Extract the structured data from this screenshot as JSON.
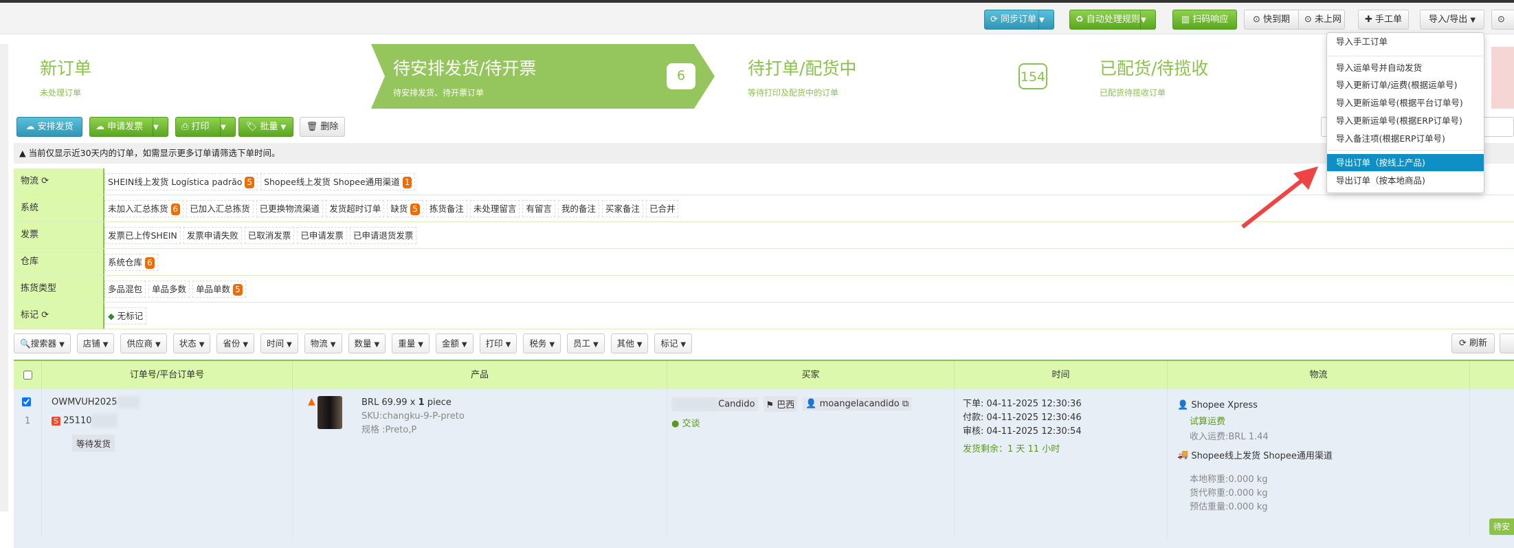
{
  "toolbar": {
    "sync": "同步订单",
    "auto_rules": "自动处理规则",
    "scan": "扫码响应",
    "expiring": "快到期",
    "not_online": "未上网",
    "manual_order": "手工单",
    "import_export": "导入/导出"
  },
  "import_export_menu": [
    "导入手工订单",
    "导入运单号并自动发货",
    "导入更新订单/运费(根据运单号)",
    "导入更新运单号(根据平台订单号)",
    "导入更新运单号(根据ERP订单号)",
    "导入备注项(根据ERP订单号)",
    "导出订单（按线上产品)",
    "导出订单（按本地商品)"
  ],
  "stages": [
    {
      "title": "新订单",
      "sub": "未处理订单",
      "count": null
    },
    {
      "title": "待安排发货/待开票",
      "sub": "待安排发货、待开票订单",
      "count": "6"
    },
    {
      "title": "待打单/配货中",
      "sub": "等待打印及配货中的订单",
      "count": "154"
    },
    {
      "title": "已配货/待揽收",
      "sub": "已配货待揽收订单",
      "count": null
    }
  ],
  "actions": {
    "arrange": "安排发货",
    "invoice": "申请发票",
    "print": "打印",
    "batch": "批量",
    "delete": "删除"
  },
  "notice": "当前仅显示近30天内的订单，如需显示更多订单请筛选下单时间。",
  "filters": [
    {
      "label": "物流",
      "chips": [
        {
          "t": "SHEIN线上发货 Logística padrão",
          "n": "5"
        },
        {
          "t": "Shopee线上发货 Shopee通用渠道",
          "n": "1"
        }
      ]
    },
    {
      "label": "系统",
      "chips": [
        {
          "t": "未加入汇总拣货",
          "n": "6"
        },
        {
          "t": "已加入汇总拣货"
        },
        {
          "t": "已更换物流渠道"
        },
        {
          "t": "发货超时订单"
        },
        {
          "t": "缺货",
          "n": "5"
        },
        {
          "t": "拣货备注"
        },
        {
          "t": "未处理留言"
        },
        {
          "t": "有留言"
        },
        {
          "t": "我的备注"
        },
        {
          "t": "买家备注"
        },
        {
          "t": "已合并"
        }
      ]
    },
    {
      "label": "发票",
      "chips": [
        {
          "t": "发票已上传SHEIN"
        },
        {
          "t": "发票申请失败"
        },
        {
          "t": "已取消发票"
        },
        {
          "t": "已申请发票"
        },
        {
          "t": "已申请退货发票"
        }
      ]
    },
    {
      "label": "仓库",
      "chips": [
        {
          "t": "系统仓库",
          "n": "6"
        }
      ]
    },
    {
      "label": "拣货类型",
      "chips": [
        {
          "t": "多品混包"
        },
        {
          "t": "单品多数"
        },
        {
          "t": "单品单数",
          "n": "5"
        }
      ]
    },
    {
      "label": "标记",
      "chips": [
        {
          "t": "无标记"
        }
      ]
    }
  ],
  "filter_buttons": [
    "搜索器",
    "店铺",
    "供应商",
    "状态",
    "省份",
    "时间",
    "物流",
    "数量",
    "重量",
    "金额",
    "打印",
    "税务",
    "员工",
    "其他",
    "标记"
  ],
  "refresh": "刷新",
  "columns": [
    "订单号/平台订单号",
    "产品",
    "买家",
    "时间",
    "物流"
  ],
  "order": {
    "index": "1",
    "order_no": "OWMVUH2025",
    "platform_no": "25110",
    "status": "等待发货",
    "price": "BRL 69.99 x",
    "qty": "1",
    "unit": "piece",
    "sku": "SKU:changku-9-P-preto",
    "spec": "规格 :Preto,P",
    "buyer_name": "Candido",
    "country": "巴西",
    "buyer_user": "moangelacandido",
    "chat": "交谈",
    "times": [
      {
        "k": "下单:",
        "v": "04-11-2025 12:30:36"
      },
      {
        "k": "付款:",
        "v": "04-11-2025 12:30:46"
      },
      {
        "k": "审核:",
        "v": "04-11-2025 12:30:54"
      }
    ],
    "remaining": "发货剩余：1 天 11 小时",
    "carrier": "Shopee Xpress",
    "calc_fee": "试算运费",
    "income_fee": "收入运费:BRL 1.44",
    "channel": "Shopee线上发货 Shopee通用渠道",
    "weights": [
      "本地称重:0.000 kg",
      "货代称重:0.000 kg",
      "预估重量:0.000 kg"
    ],
    "status_btn": "待安"
  },
  "colors": {
    "green": "#8bc34a",
    "blue": "#2f96b4",
    "highlight": "#0e8fc6",
    "badge": "#ef6c00"
  }
}
